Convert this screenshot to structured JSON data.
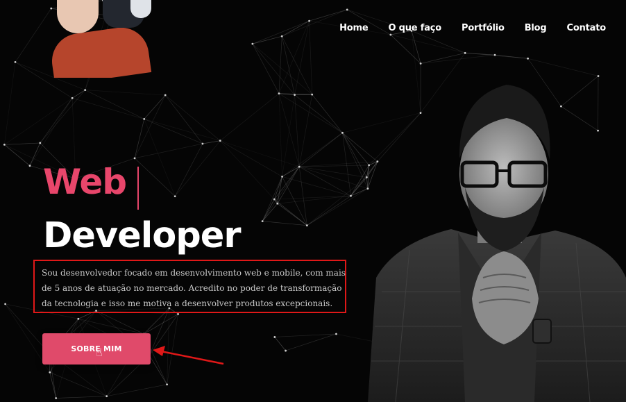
{
  "nav": {
    "items": [
      {
        "label": "Home"
      },
      {
        "label": "O que faço"
      },
      {
        "label": "Portfólio"
      },
      {
        "label": "Blog"
      },
      {
        "label": "Contato"
      }
    ]
  },
  "hero": {
    "title_accent": "Web",
    "title_main": "Developer",
    "description": "Sou desenvolvedor focado em desenvolvimento web e mobile, com mais de 5 anos de atuação no mercado. Acredito no poder de transformação da tecnologia e isso me motiva a desenvolver produtos excepcionais.",
    "button_label": "SOBRE MIM"
  },
  "colors": {
    "accent": "#e8466b",
    "button": "#e04a6a",
    "highlight_box": "#e01818",
    "background": "#050505"
  },
  "icons": [
    "network-background",
    "hand-pointer-icon",
    "red-arrow-annotation"
  ]
}
